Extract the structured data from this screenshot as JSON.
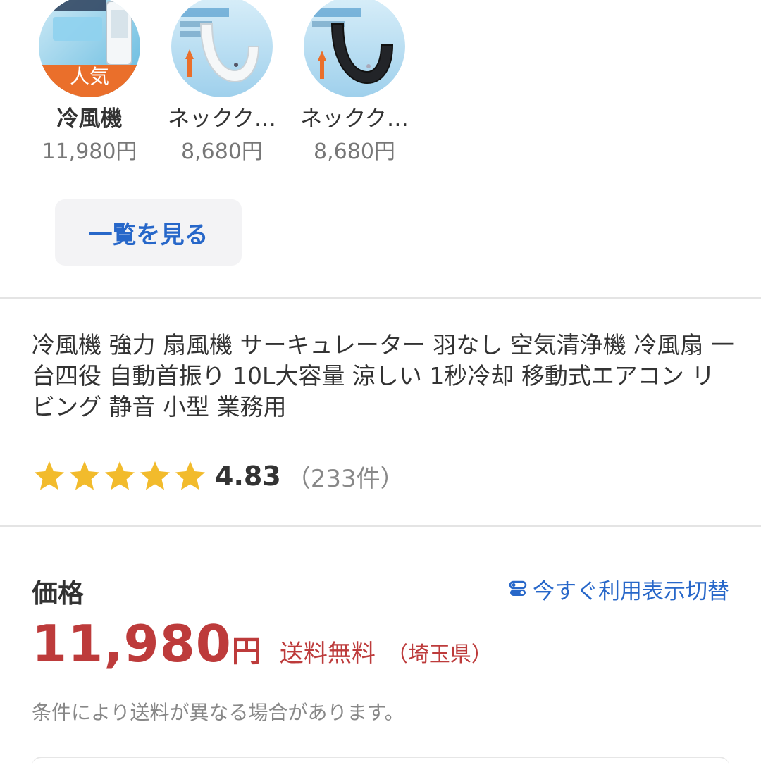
{
  "variants": [
    {
      "name": "冷風機",
      "price": "11,980円",
      "badge": "人気",
      "image": "air-cooler-product-photo"
    },
    {
      "name": "ネックク…",
      "price": "8,680円",
      "image": "white-neck-fan-product-photo"
    },
    {
      "name": "ネックク…",
      "price": "8,680円",
      "image": "black-neck-fan-product-photo"
    }
  ],
  "view_all_label": "一覧を見る",
  "product": {
    "title": "冷風機 強力 扇風機 サーキュレーター 羽なし 空気清浄機 冷風扇 一台四役 自動首振り 10L大容量 涼しい 1秒冷却 移動式エアコン リビング 静音 小型 業務用",
    "rating": {
      "stars": 5,
      "score": "4.83",
      "count": "（233件）"
    }
  },
  "price_section": {
    "label": "価格",
    "toggle_label": "今すぐ利用表示切替",
    "amount": "11,980",
    "currency": "円",
    "shipping": "送料無料",
    "location": "（埼玉県）",
    "note": "条件により送料が異なる場合があります。"
  },
  "colors": {
    "price_red": "#bd3b3b",
    "link_blue": "#2767c9",
    "star_gold": "#f2bb2c",
    "badge_orange": "#ea6f2b"
  }
}
